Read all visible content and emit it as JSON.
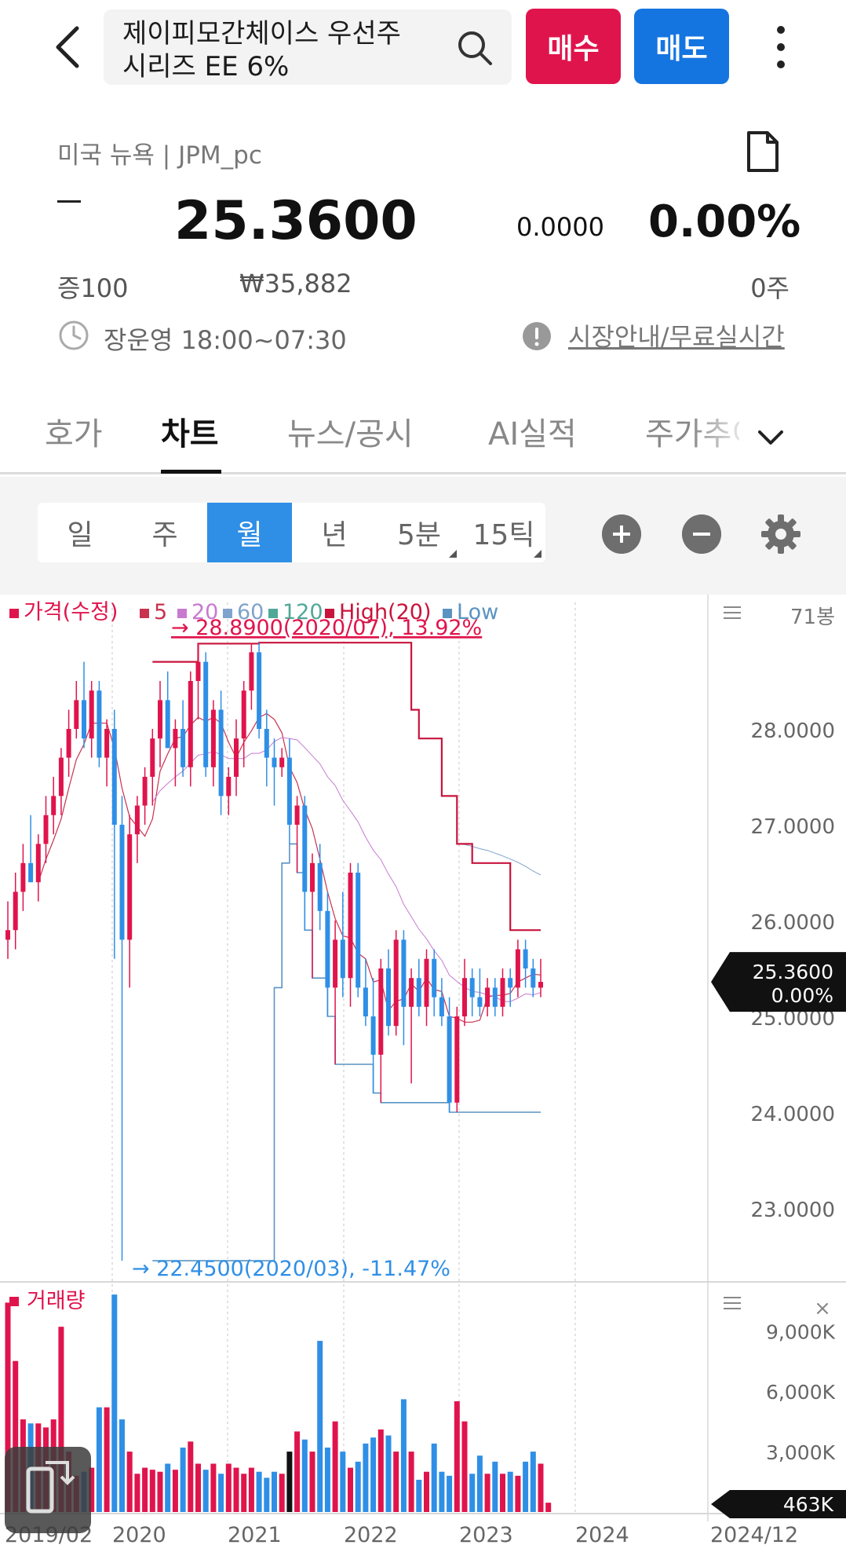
{
  "header": {
    "title": "제이피모간체이스 우선주\n시리즈 EE 6%",
    "buy_label": "매수",
    "sell_label": "매도"
  },
  "quote": {
    "market": "미국 뉴욕 | JPM_pc",
    "direction": "–",
    "price": "25.3600",
    "change": "0.0000",
    "change_pct": "0.00%",
    "margin": "증100",
    "krw_price": "₩35,882",
    "volume": "0주",
    "hours": "장운영 18:00~07:30",
    "market_guide": "시장안내/무료실시간"
  },
  "tabs": [
    {
      "label": "호가"
    },
    {
      "label": "차트"
    },
    {
      "label": "뉴스/공시"
    },
    {
      "label": "AI실적"
    },
    {
      "label": "주가추이"
    }
  ],
  "periods": [
    {
      "label": "일"
    },
    {
      "label": "주"
    },
    {
      "label": "월"
    },
    {
      "label": "년"
    },
    {
      "label": "5분"
    },
    {
      "label": "15틱"
    }
  ],
  "colors": {
    "up": "#e0144c",
    "down": "#2f8fe6",
    "ma5": "#c8324f",
    "ma20": "#c77ad0",
    "ma60": "#7fa3cc",
    "ma120": "#4fa898",
    "high20": "#c8143c",
    "low": "#5a93c2"
  },
  "chart_data": [
    {
      "type": "candlestick",
      "legend": [
        "가격(수정)",
        "5",
        "20",
        "60",
        "120",
        "High(20)",
        "Low"
      ],
      "bar_count_label": "71봉",
      "ylim": [
        22.4,
        29.1
      ],
      "y_ticks": [
        "28.0000",
        "27.0000",
        "26.0000",
        "25.0000",
        "24.0000",
        "23.0000"
      ],
      "x_ticks": [
        "2019/02",
        "2020",
        "2021",
        "2022",
        "2023",
        "2024",
        "2024/12"
      ],
      "current_price_label": "25.3600",
      "current_change_label": "0.00%",
      "max_annotation": "28.8900(2020/07), 13.92%",
      "min_annotation": "22.4500(2020/03), -11.47%",
      "candles": [
        [
          25.8,
          26.2,
          25.6,
          25.9
        ],
        [
          25.9,
          26.5,
          25.7,
          26.3
        ],
        [
          26.3,
          26.8,
          26.1,
          26.6
        ],
        [
          26.6,
          27.1,
          26.4,
          26.4
        ],
        [
          26.4,
          26.9,
          26.2,
          26.8
        ],
        [
          26.8,
          27.3,
          26.6,
          27.1
        ],
        [
          27.1,
          27.5,
          26.9,
          27.3
        ],
        [
          27.3,
          27.8,
          27.1,
          27.7
        ],
        [
          27.7,
          28.2,
          27.5,
          28.0
        ],
        [
          28.0,
          28.5,
          27.9,
          28.3
        ],
        [
          28.3,
          28.7,
          27.8,
          27.9
        ],
        [
          27.9,
          28.5,
          27.7,
          28.4
        ],
        [
          28.4,
          28.5,
          27.6,
          27.7
        ],
        [
          27.7,
          28.1,
          27.4,
          28.0
        ],
        [
          28.0,
          28.2,
          25.6,
          27.0
        ],
        [
          27.0,
          27.3,
          22.45,
          25.8
        ],
        [
          25.8,
          27.1,
          25.3,
          26.9
        ],
        [
          26.9,
          27.3,
          26.6,
          27.2
        ],
        [
          27.2,
          27.6,
          27.0,
          27.5
        ],
        [
          27.5,
          28.0,
          27.2,
          27.9
        ],
        [
          27.9,
          28.5,
          27.6,
          28.3
        ],
        [
          28.3,
          28.6,
          27.8,
          27.8
        ],
        [
          27.8,
          28.1,
          27.4,
          28.0
        ],
        [
          28.0,
          28.3,
          27.5,
          27.6
        ],
        [
          27.6,
          28.6,
          27.4,
          28.5
        ],
        [
          28.5,
          28.89,
          28.1,
          28.7
        ],
        [
          28.7,
          28.8,
          27.5,
          27.6
        ],
        [
          27.6,
          28.3,
          27.4,
          28.2
        ],
        [
          28.2,
          28.4,
          27.1,
          27.3
        ],
        [
          27.3,
          27.6,
          27.1,
          27.5
        ],
        [
          27.5,
          28.1,
          27.3,
          27.9
        ],
        [
          27.9,
          28.5,
          27.6,
          28.4
        ],
        [
          28.4,
          28.89,
          28.2,
          28.8
        ],
        [
          28.8,
          28.9,
          27.9,
          28.0
        ],
        [
          28.0,
          28.2,
          27.4,
          27.7
        ],
        [
          27.7,
          27.9,
          27.2,
          27.6
        ],
        [
          27.6,
          27.8,
          27.5,
          27.7
        ],
        [
          27.7,
          27.9,
          26.8,
          27.0
        ],
        [
          27.0,
          27.3,
          26.5,
          27.2
        ],
        [
          27.2,
          27.3,
          25.9,
          26.3
        ],
        [
          26.3,
          26.7,
          25.4,
          26.6
        ],
        [
          26.6,
          26.8,
          25.9,
          26.1
        ],
        [
          26.1,
          26.3,
          25.0,
          25.3
        ],
        [
          25.3,
          26.0,
          24.5,
          25.8
        ],
        [
          25.8,
          26.3,
          25.2,
          25.4
        ],
        [
          25.4,
          26.6,
          25.1,
          26.5
        ],
        [
          26.5,
          26.6,
          25.2,
          25.3
        ],
        [
          25.3,
          25.6,
          24.9,
          25.0
        ],
        [
          25.0,
          25.4,
          24.2,
          24.6
        ],
        [
          24.6,
          25.6,
          24.1,
          25.5
        ],
        [
          25.5,
          25.7,
          24.8,
          24.9
        ],
        [
          24.9,
          25.9,
          24.8,
          25.8
        ],
        [
          25.8,
          25.9,
          24.7,
          25.1
        ],
        [
          25.1,
          25.5,
          24.3,
          25.4
        ],
        [
          25.4,
          25.6,
          25.0,
          25.1
        ],
        [
          25.1,
          25.7,
          24.9,
          25.6
        ],
        [
          25.6,
          25.7,
          25.0,
          25.2
        ],
        [
          25.2,
          25.4,
          24.9,
          25.0
        ],
        [
          25.0,
          25.2,
          24.0,
          24.1
        ],
        [
          24.1,
          25.1,
          24.0,
          25.0
        ],
        [
          25.0,
          25.6,
          24.9,
          25.4
        ],
        [
          25.4,
          25.5,
          25.0,
          25.2
        ],
        [
          25.2,
          25.5,
          25.0,
          25.1
        ],
        [
          25.1,
          25.4,
          25.0,
          25.3
        ],
        [
          25.3,
          25.4,
          25.0,
          25.1
        ],
        [
          25.1,
          25.5,
          25.0,
          25.4
        ],
        [
          25.4,
          25.5,
          25.1,
          25.3
        ],
        [
          25.3,
          25.8,
          25.2,
          25.7
        ],
        [
          25.7,
          25.8,
          25.3,
          25.5
        ],
        [
          25.5,
          25.6,
          25.2,
          25.3
        ],
        [
          25.3,
          25.6,
          25.2,
          25.36
        ]
      ]
    },
    {
      "type": "bar",
      "legend": [
        "거래량"
      ],
      "ylim": [
        0,
        11000
      ],
      "y_ticks": [
        "9,000K",
        "6,000K",
        "3,000K"
      ],
      "current_label": "463K",
      "values": [
        10400,
        7500,
        4600,
        4400,
        4400,
        4200,
        4600,
        9200,
        3000,
        1800,
        2000,
        2200,
        5200,
        5200,
        10800,
        4600,
        3000,
        1900,
        2200,
        2100,
        2000,
        2400,
        2100,
        3200,
        3500,
        2400,
        2100,
        2400,
        1900,
        2400,
        2200,
        1900,
        2200,
        2000,
        1700,
        2000,
        1900,
        3000,
        4000,
        3600,
        3000,
        8500,
        3200,
        4500,
        3000,
        2200,
        2500,
        3400,
        3700,
        4100,
        3800,
        3000,
        5600,
        3000,
        1600,
        2000,
        3400,
        2000,
        1800,
        5500,
        4500,
        1900,
        2800,
        1900,
        2500,
        1900,
        2000,
        1800,
        2500,
        3000,
        2400,
        463
      ]
    }
  ]
}
